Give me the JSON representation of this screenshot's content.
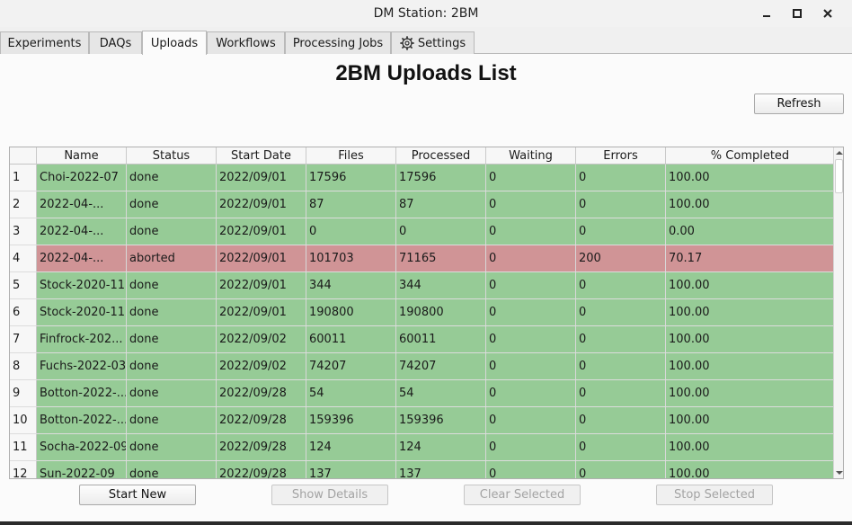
{
  "window": {
    "title": "DM Station: 2BM",
    "controls": [
      "minimize-icon",
      "maximize-icon",
      "close-icon"
    ]
  },
  "tabs": [
    {
      "label": "Experiments",
      "active": false
    },
    {
      "label": "DAQs",
      "active": false
    },
    {
      "label": "Uploads",
      "active": true
    },
    {
      "label": "Workflows",
      "active": false
    },
    {
      "label": "Processing Jobs",
      "active": false
    },
    {
      "label": "Settings",
      "active": false,
      "icon": "gear-icon"
    }
  ],
  "page": {
    "title": "2BM Uploads List",
    "refresh_label": "Refresh"
  },
  "table": {
    "columns": [
      "Name",
      "Status",
      "Start Date",
      "Files",
      "Processed",
      "Waiting",
      "Errors",
      "% Completed"
    ],
    "rows": [
      {
        "num": "1",
        "state": "done",
        "cells": [
          "Choi-2022-07",
          "done",
          "2022/09/01",
          "17596",
          "17596",
          "0",
          "0",
          "100.00"
        ]
      },
      {
        "num": "2",
        "state": "done",
        "cells": [
          "2022-04-...",
          "done",
          "2022/09/01",
          "87",
          "87",
          "0",
          "0",
          "100.00"
        ]
      },
      {
        "num": "3",
        "state": "done",
        "cells": [
          "2022-04-...",
          "done",
          "2022/09/01",
          "0",
          "0",
          "0",
          "0",
          "0.00"
        ]
      },
      {
        "num": "4",
        "state": "aborted",
        "cells": [
          "2022-04-...",
          "aborted",
          "2022/09/01",
          "101703",
          "71165",
          "0",
          "200",
          "70.17"
        ]
      },
      {
        "num": "5",
        "state": "done",
        "cells": [
          "Stock-2020-11",
          "done",
          "2022/09/01",
          "344",
          "344",
          "0",
          "0",
          "100.00"
        ]
      },
      {
        "num": "6",
        "state": "done",
        "cells": [
          "Stock-2020-11",
          "done",
          "2022/09/01",
          "190800",
          "190800",
          "0",
          "0",
          "100.00"
        ]
      },
      {
        "num": "7",
        "state": "done",
        "cells": [
          "Finfrock-202...",
          "done",
          "2022/09/02",
          "60011",
          "60011",
          "0",
          "0",
          "100.00"
        ]
      },
      {
        "num": "8",
        "state": "done",
        "cells": [
          "Fuchs-2022-03",
          "done",
          "2022/09/02",
          "74207",
          "74207",
          "0",
          "0",
          "100.00"
        ]
      },
      {
        "num": "9",
        "state": "done",
        "cells": [
          "Botton-2022-...",
          "done",
          "2022/09/28",
          "54",
          "54",
          "0",
          "0",
          "100.00"
        ]
      },
      {
        "num": "10",
        "state": "done",
        "cells": [
          "Botton-2022-...",
          "done",
          "2022/09/28",
          "159396",
          "159396",
          "0",
          "0",
          "100.00"
        ]
      },
      {
        "num": "11",
        "state": "done",
        "cells": [
          "Socha-2022-09",
          "done",
          "2022/09/28",
          "124",
          "124",
          "0",
          "0",
          "100.00"
        ]
      },
      {
        "num": "12",
        "state": "done",
        "cells": [
          "Sun-2022-09",
          "done",
          "2022/09/28",
          "137",
          "137",
          "0",
          "0",
          "100.00"
        ]
      }
    ]
  },
  "actions": {
    "start_new": "Start New",
    "show_details": "Show Details",
    "clear_selected": "Clear Selected",
    "stop_selected": "Stop Selected"
  },
  "colors": {
    "row_done": "#96cb96",
    "row_aborted": "#d09496",
    "rowhead_bg": "#f7f7f7"
  }
}
